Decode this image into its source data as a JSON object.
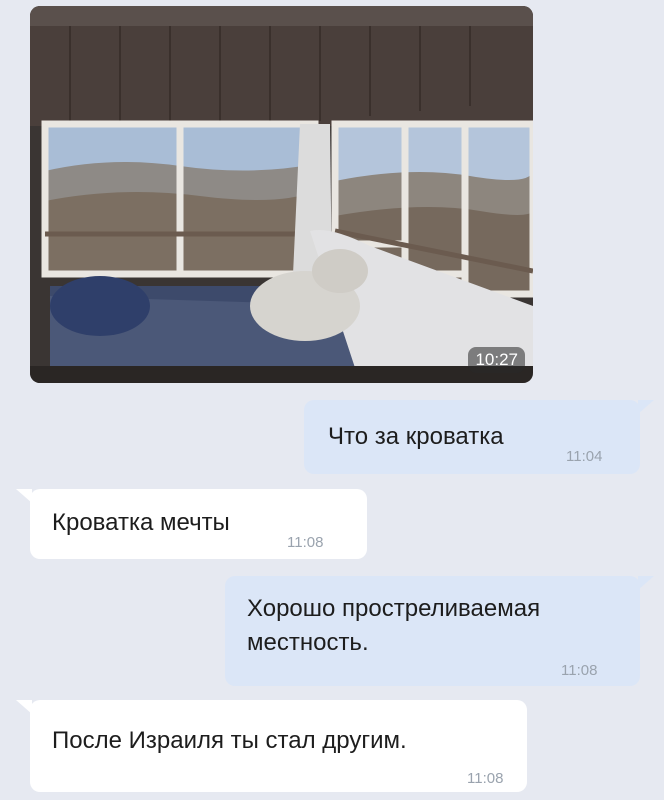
{
  "chat": {
    "photo": {
      "time": "10:27",
      "alt": "room-with-mountain-view-photo"
    },
    "messages": [
      {
        "direction": "out",
        "text": "Что за кроватка",
        "time": "11:04"
      },
      {
        "direction": "in",
        "text": "Кроватка мечты",
        "time": "11:08"
      },
      {
        "direction": "out",
        "text": "Хорошо простреливаемая местность.",
        "time": "11:08"
      },
      {
        "direction": "in",
        "text": "После Израиля ты стал другим.",
        "time": "11:08"
      }
    ]
  },
  "colors": {
    "background": "#e6e9f1",
    "outgoing_bubble": "#dbe6f7",
    "incoming_bubble": "#ffffff",
    "timestamp": "#9aa3ae"
  }
}
